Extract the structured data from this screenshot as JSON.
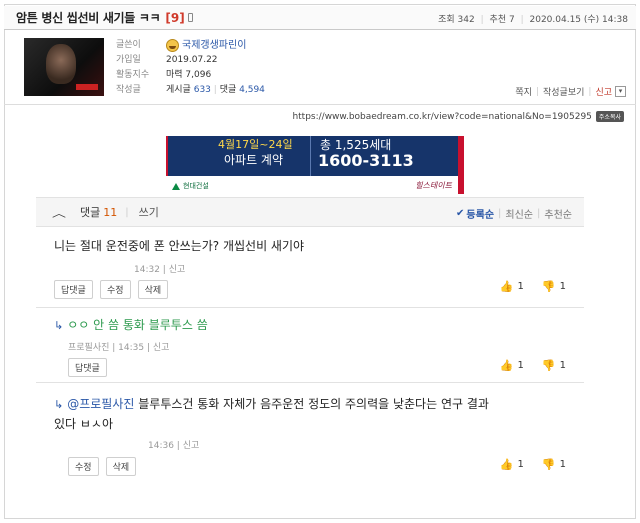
{
  "post": {
    "title": "암튼 병신 씹선비 새기들 ㅋㅋ",
    "comment_count_label": "[9]",
    "views": "조회 342",
    "recommends": "추천 7",
    "date": "2020.04.15 (수) 14:38"
  },
  "author": {
    "labels": [
      "글쓴이",
      "가입일",
      "활동지수",
      "작성글"
    ],
    "nickname": "국제갱생파린이",
    "join_date": "2019.07.22",
    "activity": "마력 7,096",
    "posts_label": "게시글",
    "posts_count": "633",
    "comments_label": "댓글",
    "comments_count": "4,594",
    "actions": {
      "note": "쪽지",
      "view_posts": "작성글보기",
      "report": "신고",
      "dropdown": "▾"
    }
  },
  "url": {
    "text": "https://www.bobaedream.co.kr/view?code=national&No=1905295",
    "copy_label": "주소복사"
  },
  "ad": {
    "line1": "4월17일~24일",
    "line2": "아파트 계약",
    "line3": "총 1,525세대",
    "phone": "1600-3113",
    "brand_left": "현대건설",
    "brand_right": "힐스테이트"
  },
  "comments_header": {
    "chevron": "︿",
    "title": "댓글",
    "count": "11",
    "write": "쓰기",
    "sort_check": "✔",
    "sort_options": [
      "등록순",
      "최신순",
      "추천순"
    ]
  },
  "comments": [
    {
      "text": "니는 절대 운전중에 폰 안쓰는가? 개씹선비 새기야",
      "meta": "14:32 | 신고",
      "buttons": [
        "답댓글",
        "수정",
        "삭제"
      ],
      "up": "1",
      "down": "1"
    },
    {
      "reply_arrow": "↳",
      "text": "ㅇㅇ 안 씀 통화 블루투스 씀",
      "meta": "프로필사진 | 14:35 | 신고",
      "buttons": [
        "답댓글"
      ],
      "up": "1",
      "down": "1"
    },
    {
      "reply_arrow": "↳",
      "mention": "@프로필사진",
      "text": "블루투스건 통화 자체가 음주운전 정도의 주의력을 낮춘다는 연구 결과",
      "text2": "있다 ㅂㅅ아",
      "meta": "14:36 | 신고",
      "buttons": [
        "수정",
        "삭제"
      ],
      "up": "1",
      "down": "1"
    }
  ],
  "icons": {
    "thumb_up": "👍",
    "thumb_down": "👎"
  }
}
